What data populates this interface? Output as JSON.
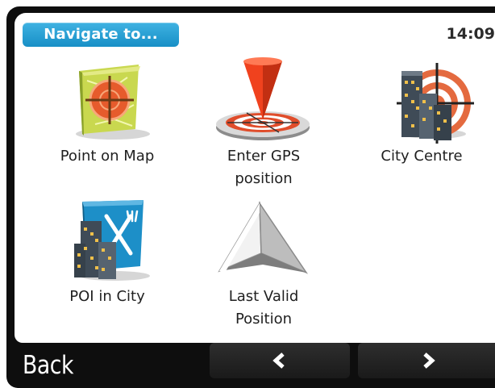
{
  "header": {
    "title": "Navigate to...",
    "time": "14:09"
  },
  "menu": {
    "items": [
      {
        "line1": "Point on Map",
        "line2": "",
        "icon": "point-on-map-icon"
      },
      {
        "line1": "Enter GPS",
        "line2": "position",
        "icon": "gps-position-icon"
      },
      {
        "line1": "City Centre",
        "line2": "",
        "icon": "city-centre-icon"
      },
      {
        "line1": "POI in City",
        "line2": "",
        "icon": "poi-in-city-icon"
      },
      {
        "line1": "Last Valid",
        "line2": "Position",
        "icon": "last-valid-position-icon"
      }
    ]
  },
  "footer": {
    "back_label": "Back",
    "prev_icon": "chevron-left-icon",
    "next_icon": "chevron-right-icon"
  },
  "colors": {
    "title_pill": "#1f9fd6",
    "background": "#0e0e0e",
    "screen": "#ffffff"
  }
}
